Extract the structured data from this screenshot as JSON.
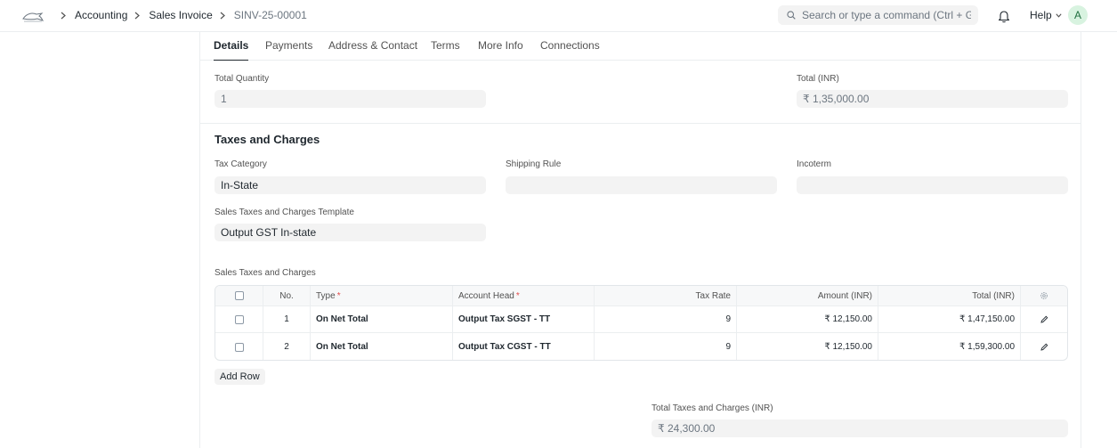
{
  "navbar": {
    "breadcrumbs": [
      "Accounting",
      "Sales Invoice",
      "SINV-25-00001"
    ],
    "search_placeholder": "Search or type a command (Ctrl + G)",
    "help_label": "Help",
    "avatar_initial": "A"
  },
  "tabs": [
    {
      "label": "Details",
      "active": true
    },
    {
      "label": "Payments",
      "active": false
    },
    {
      "label": "Address & Contact",
      "active": false
    },
    {
      "label": "Terms",
      "active": false
    },
    {
      "label": "More Info",
      "active": false
    },
    {
      "label": "Connections",
      "active": false
    }
  ],
  "totals": {
    "total_quantity_label": "Total Quantity",
    "total_quantity_value": "1",
    "total_label": "Total (INR)",
    "total_value": "₹ 1,35,000.00"
  },
  "taxes_section": {
    "title": "Taxes and Charges",
    "tax_category_label": "Tax Category",
    "tax_category_value": "In-State",
    "shipping_rule_label": "Shipping Rule",
    "shipping_rule_value": "",
    "incoterm_label": "Incoterm",
    "incoterm_value": "",
    "template_label": "Sales Taxes and Charges Template",
    "template_value": "Output GST In-state",
    "table_label": "Sales Taxes and Charges",
    "columns": {
      "no": "No.",
      "type": "Type",
      "account_head": "Account Head",
      "tax_rate": "Tax Rate",
      "amount": "Amount (INR)",
      "total": "Total (INR)"
    },
    "rows": [
      {
        "no": "1",
        "type": "On Net Total",
        "account_head": "Output Tax SGST - TT",
        "tax_rate": "9",
        "amount": "₹ 12,150.00",
        "total": "₹ 1,47,150.00"
      },
      {
        "no": "2",
        "type": "On Net Total",
        "account_head": "Output Tax CGST - TT",
        "tax_rate": "9",
        "amount": "₹ 12,150.00",
        "total": "₹ 1,59,300.00"
      }
    ],
    "add_row_label": "Add Row",
    "total_taxes_label": "Total Taxes and Charges (INR)",
    "total_taxes_value": "₹ 24,300.00"
  },
  "colors": {
    "accent_required": "#e24c4c",
    "field_bg": "#f3f3f3",
    "avatar_bg": "#d8f3e0"
  }
}
